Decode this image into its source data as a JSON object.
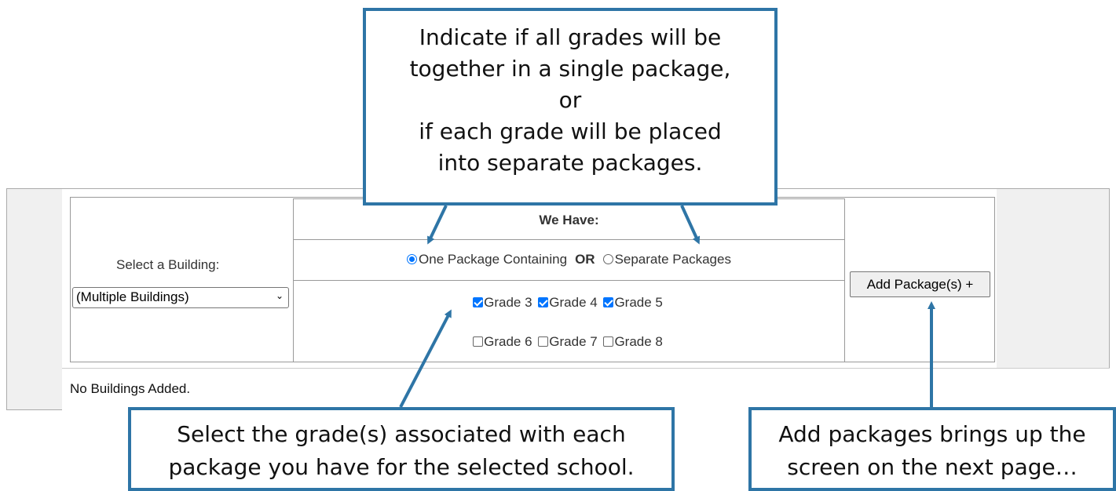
{
  "form": {
    "building_label": "Select a Building:",
    "building_selected": "(Multiple Buildings)",
    "we_have_header": "We Have:",
    "option_one_package": "One Package Containing",
    "or_word": "OR",
    "option_separate": "Separate Packages",
    "one_package_selected": true,
    "grades_row1": [
      {
        "label": "Grade 3",
        "checked": true
      },
      {
        "label": "Grade 4",
        "checked": true
      },
      {
        "label": "Grade 5",
        "checked": true
      }
    ],
    "grades_row2": [
      {
        "label": "Grade 6",
        "checked": false
      },
      {
        "label": "Grade 7",
        "checked": false
      },
      {
        "label": "Grade 8",
        "checked": false
      }
    ],
    "add_button": "Add Package(s) +",
    "status": "No Buildings Added."
  },
  "callouts": {
    "top_lines": [
      "Indicate if all grades will be",
      "together in a single package,",
      "or",
      "if each grade will be placed",
      "into separate packages."
    ],
    "left_lines": [
      "Select the grade(s) associated with each",
      "package you have for the selected school."
    ],
    "right_lines": [
      "Add packages brings up the",
      "screen on the next page…"
    ]
  },
  "colors": {
    "callout_border": "#2e75a6",
    "accent": "#0075ff"
  }
}
